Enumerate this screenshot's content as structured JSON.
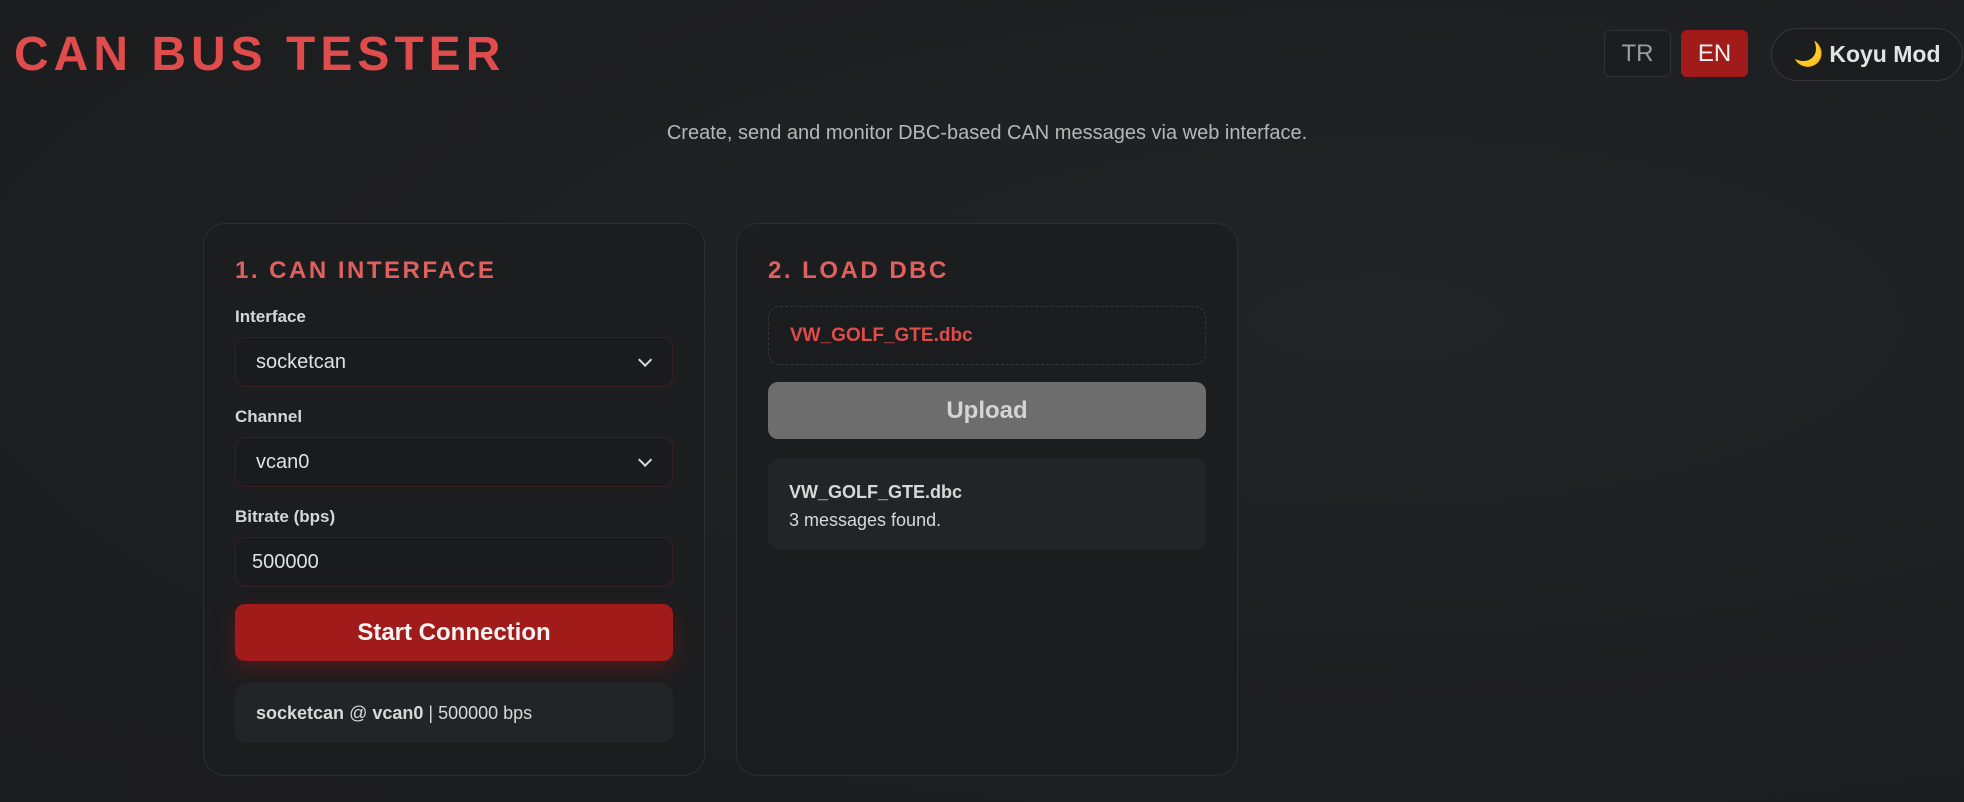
{
  "header": {
    "title": "CAN BUS TESTER",
    "lang_tr": "TR",
    "lang_en": "EN",
    "theme_label": "Koyu Mod",
    "subtitle": "Create, send and monitor DBC-based CAN messages via web interface."
  },
  "can_interface": {
    "title": "1. CAN INTERFACE",
    "interface_label": "Interface",
    "interface_value": "socketcan",
    "channel_label": "Channel",
    "channel_value": "vcan0",
    "bitrate_label": "Bitrate (bps)",
    "bitrate_value": "500000",
    "start_button": "Start Connection",
    "status_interface": "socketcan",
    "status_at": "@",
    "status_channel": "vcan0",
    "status_bitrate": "| 500000 bps"
  },
  "load_dbc": {
    "title": "2. LOAD DBC",
    "file_name": "VW_GOLF_GTE.dbc",
    "upload_button": "Upload",
    "loaded_file": "VW_GOLF_GTE.dbc",
    "messages_found": "3 messages found."
  },
  "colors": {
    "accent": "#e04b4b",
    "primary_button": "#a11b1b",
    "disabled_button": "#6d6d6d",
    "background": "#1e1f21"
  },
  "icons": {
    "theme": "moon-icon",
    "dropdown": "chevron-down-icon"
  }
}
